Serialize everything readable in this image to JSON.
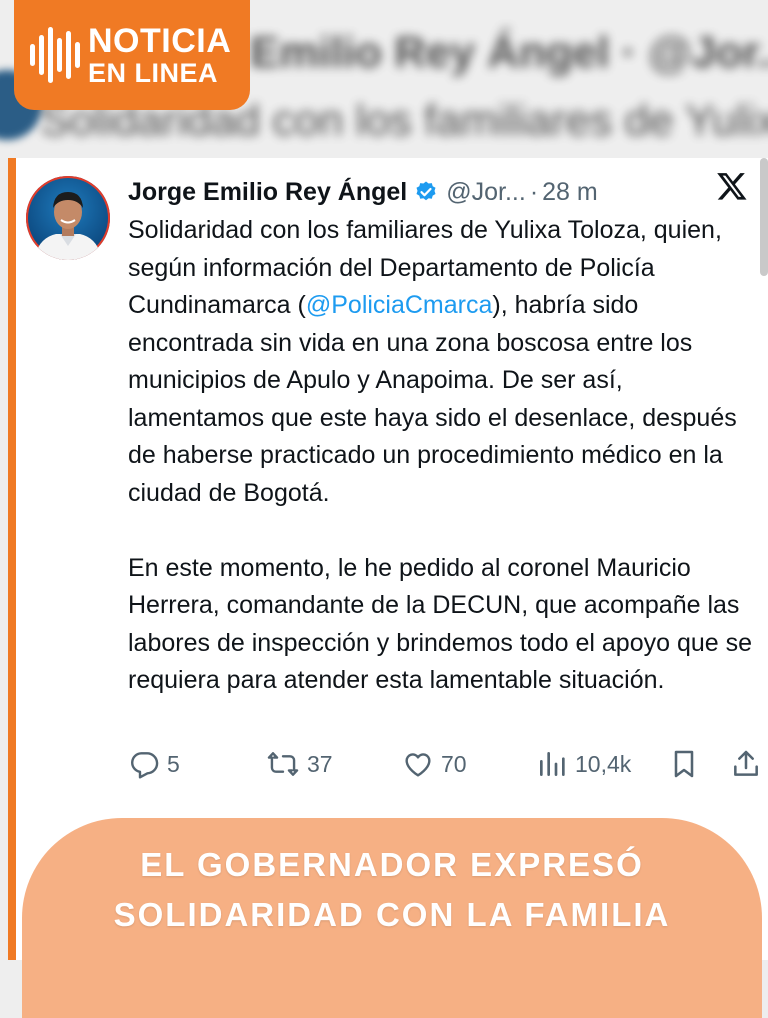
{
  "brand": {
    "line1": "NOTICIA",
    "line2": "EN LINEA",
    "color": "#f07a24"
  },
  "tweet": {
    "author_name": "Jorge Emilio Rey Ángel",
    "handle": "@Jor...",
    "separator": "·",
    "time": "28 m",
    "body": {
      "p1_before": "Solidaridad con los familiares de Yulixa Toloza, quien, según información del Departamento de Policía Cundinamarca (",
      "mention": "@PoliciaCmarca",
      "p1_after": "), habría sido encontrada sin vida en una zona boscosa entre los municipios de Apulo y Anapoima. De ser así, lamentamos que este haya sido el desenlace, después de haberse practicado un procedimiento médico en la ciudad de Bogotá.",
      "p2": "En este momento, le he pedido al coronel Mauricio Herrera, comandante de la DECUN, que acompañe las labores de inspección y brindemos todo el apoyo que se requiera para atender esta lamentable situación."
    },
    "stats": {
      "replies": "5",
      "reposts": "37",
      "likes": "70",
      "views": "10,4k"
    },
    "icons": [
      "verified-badge-icon",
      "x-logo-icon",
      "reply-icon",
      "repost-icon",
      "like-icon",
      "views-icon",
      "bookmark-icon",
      "share-icon"
    ],
    "accent_color": "#1d9bf0"
  },
  "footer": {
    "line1": "EL GOBERNADOR EXPRESÓ",
    "line2": "SOLIDARIDAD CON LA FAMILIA",
    "color": "#f6ad80"
  }
}
